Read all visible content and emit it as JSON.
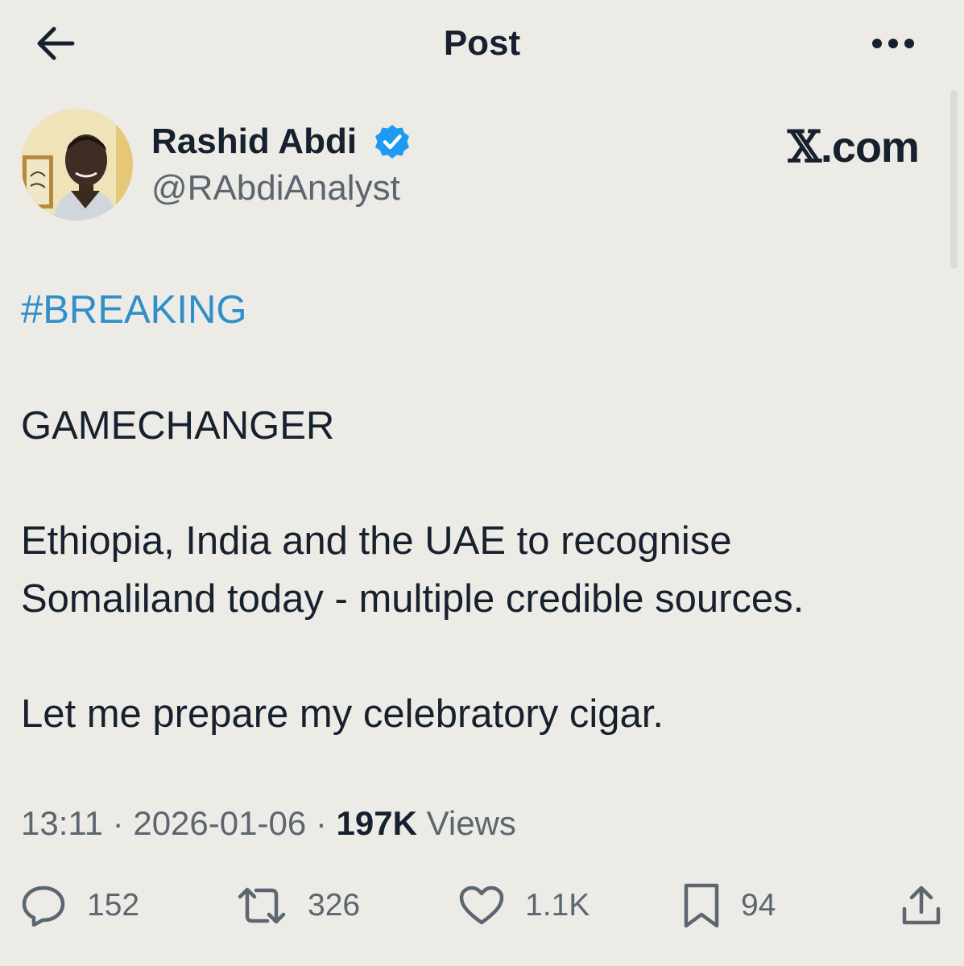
{
  "header": {
    "title": "Post"
  },
  "author": {
    "display_name": "Rashid Abdi",
    "handle": "@RAbdiAnalyst",
    "verified": true
  },
  "watermark": {
    "x": "𝕏",
    "suffix": ".com"
  },
  "post": {
    "hashtag": "#BREAKING",
    "line1": "GAMECHANGER",
    "line2a": "Ethiopia, India and the UAE to recognise",
    "line2b": "Somaliland today - multiple credible sources.",
    "line3": "Let me prepare my celebratory cigar."
  },
  "meta": {
    "time": "13:11",
    "sep1": "·",
    "date": "2026-01-06",
    "sep2": "·",
    "views_count": "197K",
    "views_label": "Views"
  },
  "actions": {
    "replies": "152",
    "reposts": "326",
    "likes": "1.1K",
    "bookmarks": "94"
  },
  "icons": {
    "back": "arrow-left-icon",
    "more": "more-horizontal-icon",
    "verified": "verified-badge-icon",
    "reply": "reply-icon",
    "repost": "repost-icon",
    "like": "heart-icon",
    "bookmark": "bookmark-icon",
    "share": "share-icon"
  },
  "colors": {
    "background": "#ecebe5",
    "text": "#16202e",
    "secondary": "#5b6670",
    "link": "#2f8fc9",
    "verified": "#1d9bf0"
  }
}
